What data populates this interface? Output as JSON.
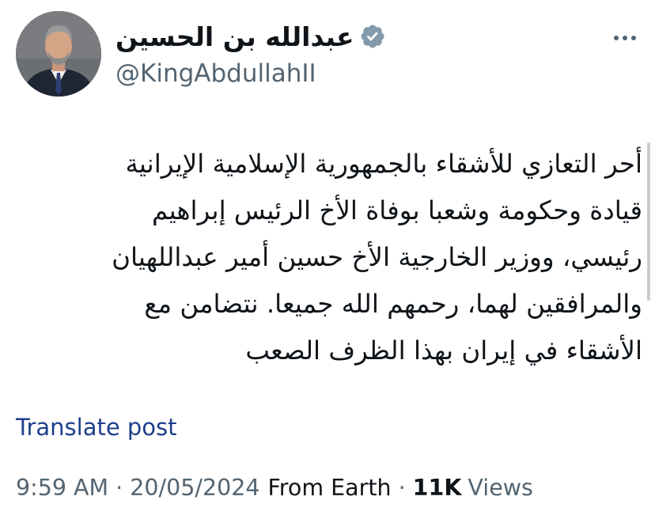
{
  "author": {
    "display_name": "عبدالله بن الحسين",
    "handle": "@KingAbdullahII",
    "verified_badge_color": "#829aab"
  },
  "icons": {
    "verified": "verified-badge-icon",
    "more": "more-horizontal-icon"
  },
  "post": {
    "lines": [
      "أحر التعازي للأشقاء بالجمهورية الإسلامية الإيرانية",
      "قيادة وحكومة وشعبا بوفاة الأخ الرئيس إبراهيم",
      "رئيسي، ووزير الخارجية الأخ حسين أمير عبداللهيان",
      "والمرافقين لهما، رحمهم الله جميعا. نتضامن مع",
      "الأشقاء في إيران بهذا الظرف الصعب"
    ]
  },
  "translate_label": "Translate post",
  "meta": {
    "time": "9:59 AM",
    "separator": "·",
    "date": "20/05/2024",
    "source": "From Earth",
    "views_count": "11K",
    "views_label": "Views"
  },
  "colors": {
    "text_primary": "#0f1419",
    "text_secondary": "#536471",
    "link": "#1d3f8c"
  }
}
